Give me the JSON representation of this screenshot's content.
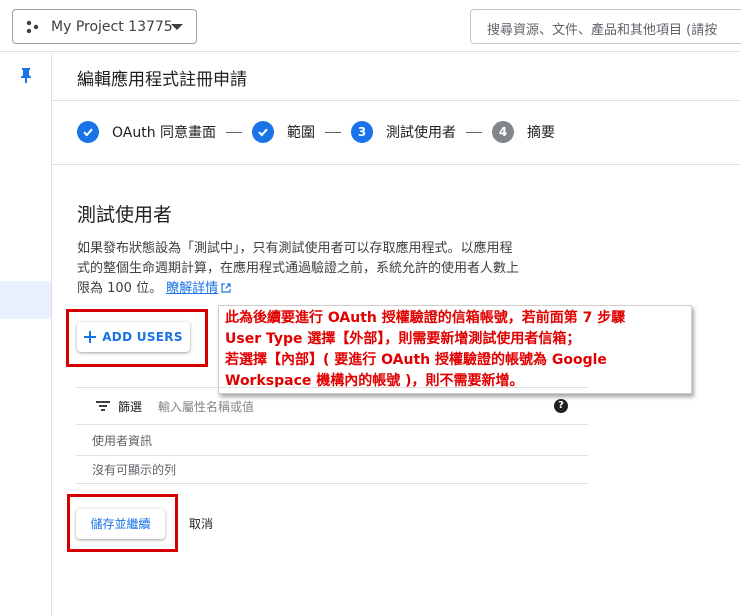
{
  "header": {
    "project_name": "My Project 13775",
    "search_placeholder": "搜尋資源、文件、產品和其他項目 (請按"
  },
  "page": {
    "title": "編輯應用程式註冊申請"
  },
  "stepper": {
    "steps": [
      {
        "number": "1",
        "label": "OAuth 同意畫面",
        "state": "done"
      },
      {
        "number": "2",
        "label": "範圍",
        "state": "done"
      },
      {
        "number": "3",
        "label": "測試使用者",
        "state": "current"
      },
      {
        "number": "4",
        "label": "摘要",
        "state": "todo"
      }
    ]
  },
  "section": {
    "title": "測試使用者",
    "desc_line1": "如果發布狀態設為「測試中」，只有測試使用者可以存取應用程式。以應用程",
    "desc_line2": "式的整個生命週期計算，在應用程式通過驗證之前，系統允許的使用者人數上",
    "desc_line3": "限為 100 位。",
    "learn_more": "瞭解詳情",
    "add_users_label": "ADD USERS"
  },
  "callout": {
    "line1": "此為後續要進行 OAuth 授權驗證的信箱帳號，若前面第 7 步驟",
    "line2": "User Type 選擇【外部】，則需要新增測試使用者信箱；",
    "line3": "若選擇【內部】( 要進行 OAuth 授權驗證的帳號為 Google",
    "line4": "Workspace 機構內的帳號 )，則不需要新增。"
  },
  "table": {
    "filter_label": "篩選",
    "filter_placeholder": "輸入屬性名稱或值",
    "column_header": "使用者資訊",
    "empty_text": "沒有可顯示的列"
  },
  "actions": {
    "save_label": "儲存並繼續",
    "cancel_label": "取消"
  },
  "colors": {
    "accent": "#1a73e8",
    "annotation": "#d50000"
  }
}
